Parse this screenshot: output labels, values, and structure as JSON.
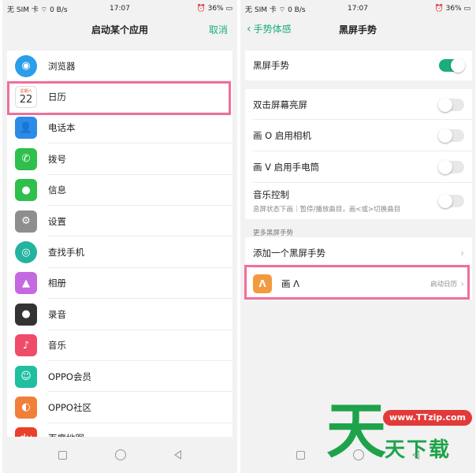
{
  "status_bar": {
    "carrier": "无 SIM 卡",
    "speed": "0 B/s",
    "time": "17:07",
    "battery": "36%"
  },
  "left_screen": {
    "title": "启动某个应用",
    "cancel_label": "取消",
    "apps": [
      {
        "label": "浏览器",
        "icon": "browser-icon",
        "color": "#2a9ee8",
        "glyph": "◉"
      },
      {
        "label": "日历",
        "icon": "calendar-icon",
        "color": "#ffffff",
        "glyph": "22",
        "sub": "星期六"
      },
      {
        "label": "电话本",
        "icon": "contacts-icon",
        "color": "#2d8be8",
        "glyph": "👤"
      },
      {
        "label": "拨号",
        "icon": "phone-icon",
        "color": "#2fbf4c",
        "glyph": "✆"
      },
      {
        "label": "信息",
        "icon": "message-icon",
        "color": "#2fbf4c",
        "glyph": "●"
      },
      {
        "label": "设置",
        "icon": "gear-icon",
        "color": "#8e8e8e",
        "glyph": "⚙"
      },
      {
        "label": "查找手机",
        "icon": "find-phone-icon",
        "color": "#24b3a0",
        "glyph": "◎"
      },
      {
        "label": "相册",
        "icon": "album-icon",
        "color": "#c569e0",
        "glyph": "▲"
      },
      {
        "label": "录音",
        "icon": "recorder-icon",
        "color": "#333333",
        "glyph": "●"
      },
      {
        "label": "音乐",
        "icon": "music-icon",
        "color": "#ef4c6a",
        "glyph": "♪"
      },
      {
        "label": "OPPO会员",
        "icon": "oppo-member-icon",
        "color": "#1fbfa0",
        "glyph": "☺"
      },
      {
        "label": "OPPO社区",
        "icon": "oppo-community-icon",
        "color": "#f07f3a",
        "glyph": "◐"
      },
      {
        "label": "百度地图",
        "icon": "baidu-map-icon",
        "color": "#e8402b",
        "glyph": "du"
      }
    ]
  },
  "right_screen": {
    "back_label": "手势体感",
    "title": "黑屏手势",
    "master": {
      "label": "黑屏手势",
      "on": true
    },
    "options": [
      {
        "label": "双击屏幕亮屏",
        "on": false
      },
      {
        "label": "画 O 启用相机",
        "on": false
      },
      {
        "label": "画 V 启用手电筒",
        "on": false
      },
      {
        "label": "音乐控制",
        "sub": "息屏状态下画｜暂停/播放曲目，画<或>切换曲目",
        "on": false
      }
    ],
    "section_label": "更多黑屏手势",
    "add_gesture_label": "添加一个黑屏手势",
    "custom_gesture": {
      "badge": "Λ",
      "label": "画 Λ",
      "target": "启动日历"
    }
  },
  "watermark": {
    "big_char": "天",
    "url": "www.TTzip.com",
    "text": "天下载"
  },
  "colors": {
    "accent": "#1aae79",
    "highlight": "#ef6f9d"
  }
}
